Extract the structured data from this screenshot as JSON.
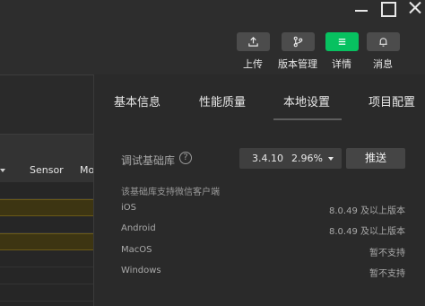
{
  "toolbar": {
    "upload": {
      "label": "上传",
      "icon": "upload-icon"
    },
    "version": {
      "label": "版本管理",
      "icon": "branch-icon"
    },
    "detail": {
      "label": "详情",
      "icon": "menu-icon",
      "accent": "#07c160"
    },
    "messages": {
      "label": "消息",
      "icon": "bell-icon"
    }
  },
  "left": {
    "columns": [
      "Sensor",
      "Mo"
    ]
  },
  "tabs": [
    {
      "label": "基本信息"
    },
    {
      "label": "性能质量"
    },
    {
      "label": "本地设置",
      "active": true
    },
    {
      "label": "项目配置"
    }
  ],
  "debug_lib": {
    "label": "调试基础库",
    "help": "?",
    "version": "3.4.10",
    "percent": "2.96%",
    "push_label": "推送"
  },
  "support": {
    "title": "该基础库支持微信客户端",
    "rows": [
      {
        "platform": "iOS",
        "value": "8.0.49 及以上版本"
      },
      {
        "platform": "Android",
        "value": "8.0.49 及以上版本"
      },
      {
        "platform": "MacOS",
        "value": "暂不支持"
      },
      {
        "platform": "Windows",
        "value": "暂不支持"
      }
    ]
  }
}
